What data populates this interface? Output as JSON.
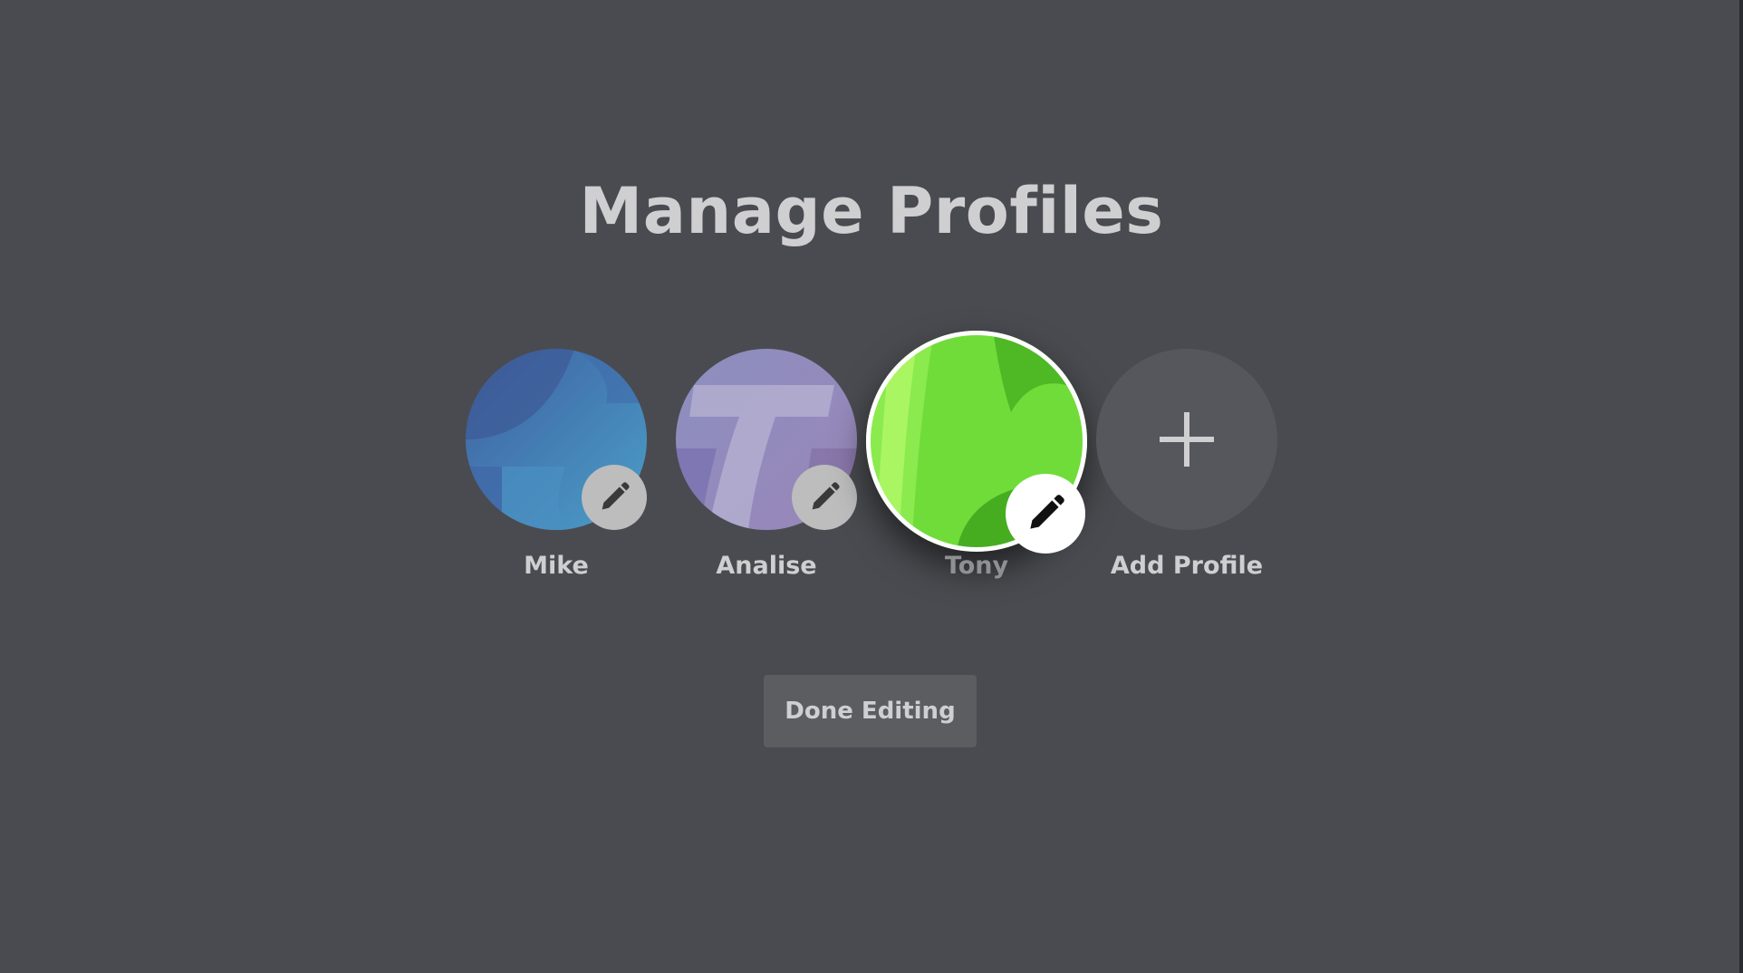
{
  "page": {
    "title": "Manage Profiles"
  },
  "profiles": [
    {
      "name": "Mike",
      "avatar": "blue-gradient-avatar",
      "edit_icon": "pencil-icon"
    },
    {
      "name": "Analise",
      "avatar": "purple-gradient-avatar",
      "edit_icon": "pencil-icon"
    },
    {
      "name": "Tony",
      "avatar": "green-gradient-avatar",
      "edit_icon": "pencil-icon",
      "focused": true
    }
  ],
  "add_profile": {
    "label": "Add Profile",
    "icon": "plus-icon"
  },
  "actions": {
    "done_label": "Done Editing"
  },
  "colors": {
    "background": "#4a4b50",
    "text": "#cfcfd1",
    "button": "#5c5d61",
    "focus_ring": "#ffffff"
  }
}
